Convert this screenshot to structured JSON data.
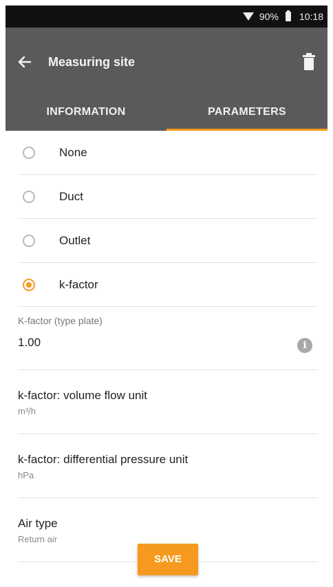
{
  "status": {
    "battery": "90%",
    "time": "10:18"
  },
  "appbar": {
    "title": "Measuring site"
  },
  "tabs": [
    {
      "label": "INFORMATION",
      "active": false
    },
    {
      "label": "PARAMETERS",
      "active": true
    }
  ],
  "options": [
    {
      "label": "None",
      "checked": false
    },
    {
      "label": "Duct",
      "checked": false
    },
    {
      "label": "Outlet",
      "checked": false
    },
    {
      "label": "k-factor",
      "checked": true
    }
  ],
  "kfactor_field": {
    "label": "K-factor (type plate)",
    "value": "1.00",
    "info_icon": "i"
  },
  "settings": [
    {
      "title": "k-factor: volume flow unit",
      "value": "m³/h"
    },
    {
      "title": "k-factor: differential pressure unit",
      "value": "hPa"
    },
    {
      "title": "Air type",
      "value": "Return air"
    }
  ],
  "save_label": "SAVE",
  "colors": {
    "accent": "#f59a1f",
    "appbar": "#5a5a5a",
    "statusbar": "#111111"
  }
}
